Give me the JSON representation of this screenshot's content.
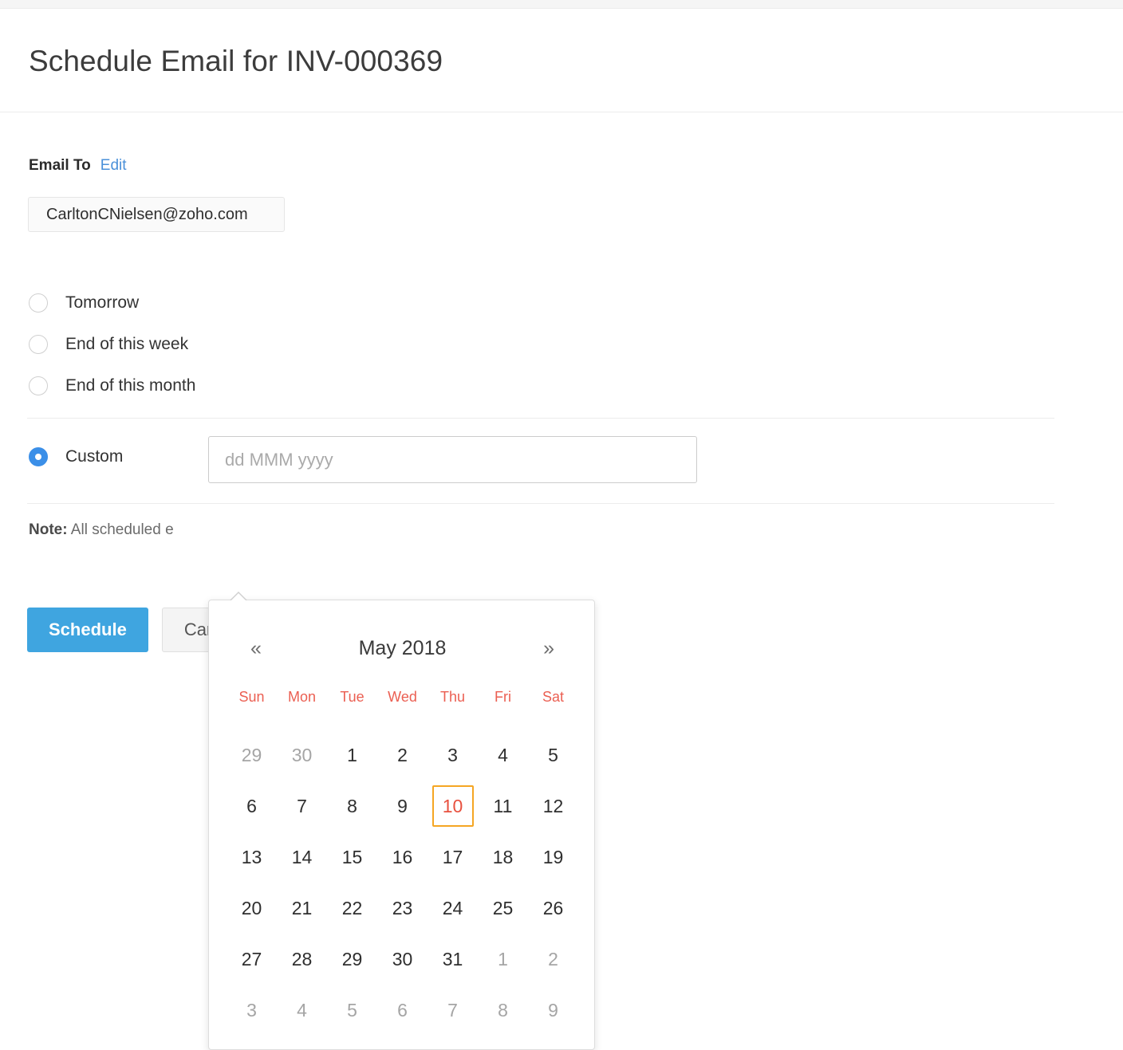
{
  "header": {
    "title": "Schedule Email for INV-000369"
  },
  "email_section": {
    "label": "Email To",
    "edit_label": "Edit",
    "recipient": "CarltonCNielsen@zoho.com"
  },
  "schedule_options": [
    {
      "id": "tomorrow",
      "label": "Tomorrow",
      "selected": false
    },
    {
      "id": "end-of-week",
      "label": "End of this week",
      "selected": false
    },
    {
      "id": "end-of-month",
      "label": "End of this month",
      "selected": false
    }
  ],
  "custom_option": {
    "label": "Custom",
    "selected": true,
    "date_placeholder": "dd MMM yyyy",
    "date_value": ""
  },
  "note": {
    "prefix": "Note:",
    "text": "All scheduled e"
  },
  "actions": {
    "primary_label": "Schedule",
    "secondary_label": "Cancel"
  },
  "datepicker": {
    "prev_glyph": "«",
    "next_glyph": "»",
    "title": "May 2018",
    "month": "May",
    "year": 2018,
    "weekdays": [
      "Sun",
      "Mon",
      "Tue",
      "Wed",
      "Thu",
      "Fri",
      "Sat"
    ],
    "today": 10,
    "weeks": [
      [
        {
          "d": "29",
          "muted": true,
          "today": false
        },
        {
          "d": "30",
          "muted": true,
          "today": false
        },
        {
          "d": "1",
          "muted": false,
          "today": false
        },
        {
          "d": "2",
          "muted": false,
          "today": false
        },
        {
          "d": "3",
          "muted": false,
          "today": false
        },
        {
          "d": "4",
          "muted": false,
          "today": false
        },
        {
          "d": "5",
          "muted": false,
          "today": false
        }
      ],
      [
        {
          "d": "6",
          "muted": false,
          "today": false
        },
        {
          "d": "7",
          "muted": false,
          "today": false
        },
        {
          "d": "8",
          "muted": false,
          "today": false
        },
        {
          "d": "9",
          "muted": false,
          "today": false
        },
        {
          "d": "10",
          "muted": false,
          "today": true
        },
        {
          "d": "11",
          "muted": false,
          "today": false
        },
        {
          "d": "12",
          "muted": false,
          "today": false
        }
      ],
      [
        {
          "d": "13",
          "muted": false,
          "today": false
        },
        {
          "d": "14",
          "muted": false,
          "today": false
        },
        {
          "d": "15",
          "muted": false,
          "today": false
        },
        {
          "d": "16",
          "muted": false,
          "today": false
        },
        {
          "d": "17",
          "muted": false,
          "today": false
        },
        {
          "d": "18",
          "muted": false,
          "today": false
        },
        {
          "d": "19",
          "muted": false,
          "today": false
        }
      ],
      [
        {
          "d": "20",
          "muted": false,
          "today": false
        },
        {
          "d": "21",
          "muted": false,
          "today": false
        },
        {
          "d": "22",
          "muted": false,
          "today": false
        },
        {
          "d": "23",
          "muted": false,
          "today": false
        },
        {
          "d": "24",
          "muted": false,
          "today": false
        },
        {
          "d": "25",
          "muted": false,
          "today": false
        },
        {
          "d": "26",
          "muted": false,
          "today": false
        }
      ],
      [
        {
          "d": "27",
          "muted": false,
          "today": false
        },
        {
          "d": "28",
          "muted": false,
          "today": false
        },
        {
          "d": "29",
          "muted": false,
          "today": false
        },
        {
          "d": "30",
          "muted": false,
          "today": false
        },
        {
          "d": "31",
          "muted": false,
          "today": false
        },
        {
          "d": "1",
          "muted": true,
          "today": false
        },
        {
          "d": "2",
          "muted": true,
          "today": false
        }
      ],
      [
        {
          "d": "3",
          "muted": true,
          "today": false
        },
        {
          "d": "4",
          "muted": true,
          "today": false
        },
        {
          "d": "5",
          "muted": true,
          "today": false
        },
        {
          "d": "6",
          "muted": true,
          "today": false
        },
        {
          "d": "7",
          "muted": true,
          "today": false
        },
        {
          "d": "8",
          "muted": true,
          "today": false
        },
        {
          "d": "9",
          "muted": true,
          "today": false
        }
      ]
    ]
  },
  "colors": {
    "accent_blue": "#3fa5e0",
    "radio_blue": "#3b8fe8",
    "link_blue": "#4a90d9",
    "weekday_red": "#eb5f52",
    "today_text": "#e8513f",
    "today_border": "#f5a623"
  }
}
